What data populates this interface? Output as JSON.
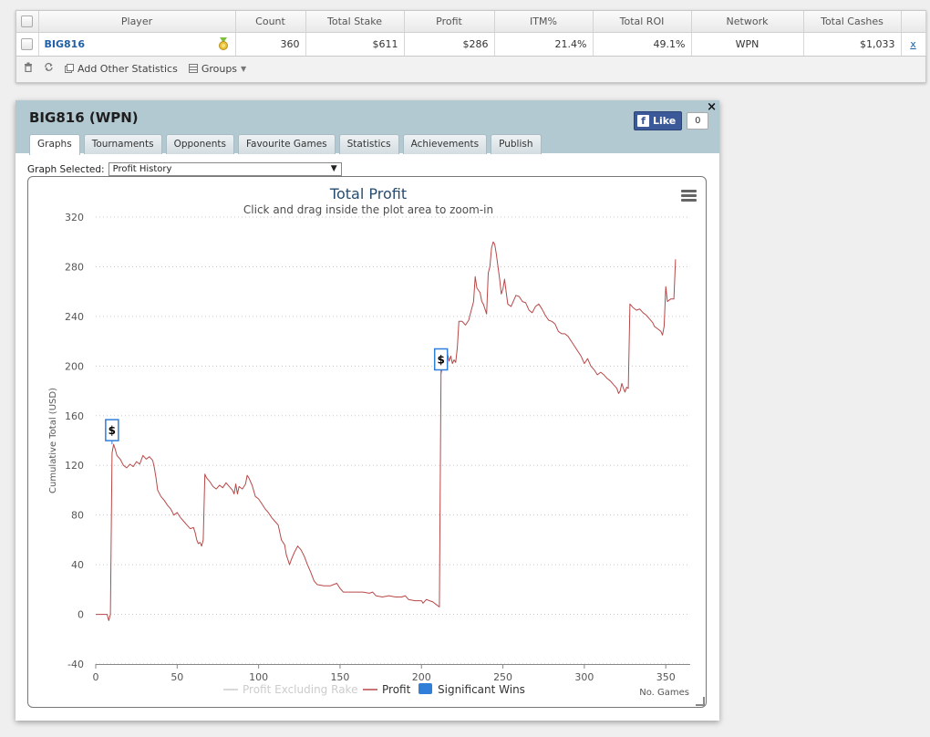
{
  "stats_table": {
    "headers": [
      "Player",
      "Count",
      "Total Stake",
      "Profit",
      "ITM%",
      "Total ROI",
      "Network",
      "Total Cashes"
    ],
    "row": {
      "player": "BIG816",
      "count": "360",
      "total_stake": "$611",
      "profit": "$286",
      "itm": "21.4%",
      "roi": "49.1%",
      "network": "WPN",
      "total_cashes": "$1,033",
      "remove": "x"
    },
    "toolbar": {
      "add_stats": "Add Other Statistics",
      "groups": "Groups"
    }
  },
  "panel": {
    "title": "BIG816 (WPN)",
    "close": "×",
    "like_label": "Like",
    "like_count": "0",
    "tabs": [
      "Graphs",
      "Tournaments",
      "Opponents",
      "Favourite Games",
      "Statistics",
      "Achievements",
      "Publish"
    ],
    "active_tab": "Graphs",
    "graph_selected_label": "Graph Selected:",
    "graph_selected_value": "Profit History"
  },
  "chart_data": {
    "type": "line",
    "title": "Total Profit",
    "subtitle": "Click and drag inside the plot area to zoom-in",
    "xlabel": "No. Games",
    "ylabel": "Cumulative Total (USD)",
    "xlim": [
      0,
      365
    ],
    "ylim": [
      -40,
      320
    ],
    "x_ticks": [
      0,
      50,
      100,
      150,
      200,
      250,
      300,
      350
    ],
    "y_ticks": [
      -40,
      0,
      40,
      80,
      120,
      160,
      200,
      240,
      280,
      320
    ],
    "grid": true,
    "legend": "bottom-center",
    "colors": {
      "profit": "#b84848",
      "profit_ex_rake": "#cccccc",
      "significant_wins": "#2f7ed8"
    },
    "legend_items": [
      "Profit Excluding Rake",
      "Profit",
      "Significant Wins"
    ],
    "series": [
      {
        "name": "Profit",
        "points": [
          [
            0,
            0
          ],
          [
            4,
            0
          ],
          [
            7,
            0
          ],
          [
            8,
            -5
          ],
          [
            9,
            0
          ],
          [
            10,
            130
          ],
          [
            11,
            137
          ],
          [
            12,
            133
          ],
          [
            13,
            128
          ],
          [
            15,
            125
          ],
          [
            17,
            120
          ],
          [
            19,
            118
          ],
          [
            21,
            121
          ],
          [
            23,
            119
          ],
          [
            25,
            123
          ],
          [
            27,
            121
          ],
          [
            29,
            128
          ],
          [
            31,
            125
          ],
          [
            33,
            127
          ],
          [
            35,
            124
          ],
          [
            36,
            118
          ],
          [
            37,
            110
          ],
          [
            38,
            100
          ],
          [
            40,
            95
          ],
          [
            42,
            92
          ],
          [
            44,
            88
          ],
          [
            46,
            85
          ],
          [
            48,
            80
          ],
          [
            50,
            82
          ],
          [
            52,
            78
          ],
          [
            54,
            75
          ],
          [
            56,
            72
          ],
          [
            58,
            69
          ],
          [
            60,
            70
          ],
          [
            61,
            66
          ],
          [
            62,
            60
          ],
          [
            63,
            57
          ],
          [
            64,
            58
          ],
          [
            65,
            55
          ],
          [
            66,
            60
          ],
          [
            67,
            113
          ],
          [
            68,
            110
          ],
          [
            70,
            107
          ],
          [
            72,
            103
          ],
          [
            74,
            101
          ],
          [
            76,
            104
          ],
          [
            78,
            102
          ],
          [
            80,
            106
          ],
          [
            82,
            103
          ],
          [
            84,
            100
          ],
          [
            85,
            97
          ],
          [
            86,
            105
          ],
          [
            87,
            97
          ],
          [
            88,
            103
          ],
          [
            90,
            101
          ],
          [
            92,
            105
          ],
          [
            93,
            112
          ],
          [
            94,
            110
          ],
          [
            96,
            104
          ],
          [
            98,
            95
          ],
          [
            100,
            93
          ],
          [
            102,
            89
          ],
          [
            104,
            85
          ],
          [
            106,
            82
          ],
          [
            108,
            78
          ],
          [
            110,
            75
          ],
          [
            112,
            72
          ],
          [
            113,
            66
          ],
          [
            114,
            60
          ],
          [
            116,
            56
          ],
          [
            117,
            48
          ],
          [
            118,
            44
          ],
          [
            119,
            40
          ],
          [
            120,
            44
          ],
          [
            122,
            50
          ],
          [
            124,
            55
          ],
          [
            126,
            52
          ],
          [
            128,
            47
          ],
          [
            130,
            40
          ],
          [
            132,
            34
          ],
          [
            134,
            27
          ],
          [
            136,
            24
          ],
          [
            140,
            23
          ],
          [
            144,
            23
          ],
          [
            146,
            24
          ],
          [
            148,
            25
          ],
          [
            150,
            21
          ],
          [
            152,
            18
          ],
          [
            156,
            18
          ],
          [
            160,
            18
          ],
          [
            164,
            18
          ],
          [
            168,
            17
          ],
          [
            170,
            18
          ],
          [
            172,
            15
          ],
          [
            176,
            14
          ],
          [
            180,
            15
          ],
          [
            184,
            14
          ],
          [
            188,
            14
          ],
          [
            190,
            15
          ],
          [
            192,
            12
          ],
          [
            196,
            11
          ],
          [
            200,
            11
          ],
          [
            201,
            9
          ],
          [
            203,
            12
          ],
          [
            205,
            11
          ],
          [
            207,
            10
          ],
          [
            209,
            8
          ],
          [
            211,
            6
          ],
          [
            212,
            194
          ],
          [
            213,
            200
          ],
          [
            214,
            197
          ],
          [
            215,
            202
          ],
          [
            216,
            210
          ],
          [
            217,
            204
          ],
          [
            218,
            208
          ],
          [
            219,
            202
          ],
          [
            220,
            205
          ],
          [
            221,
            203
          ],
          [
            222,
            215
          ],
          [
            223,
            236
          ],
          [
            225,
            236
          ],
          [
            227,
            233
          ],
          [
            229,
            237
          ],
          [
            230,
            242
          ],
          [
            232,
            252
          ],
          [
            233,
            272
          ],
          [
            234,
            263
          ],
          [
            236,
            259
          ],
          [
            237,
            252
          ],
          [
            238,
            250
          ],
          [
            240,
            242
          ],
          [
            241,
            275
          ],
          [
            242,
            280
          ],
          [
            243,
            295
          ],
          [
            244,
            300
          ],
          [
            245,
            298
          ],
          [
            246,
            290
          ],
          [
            247,
            280
          ],
          [
            248,
            270
          ],
          [
            249,
            258
          ],
          [
            250,
            262
          ],
          [
            251,
            270
          ],
          [
            252,
            260
          ],
          [
            253,
            250
          ],
          [
            255,
            248
          ],
          [
            257,
            254
          ],
          [
            258,
            257
          ],
          [
            260,
            256
          ],
          [
            262,
            252
          ],
          [
            264,
            251
          ],
          [
            266,
            245
          ],
          [
            268,
            243
          ],
          [
            270,
            248
          ],
          [
            272,
            250
          ],
          [
            274,
            246
          ],
          [
            276,
            241
          ],
          [
            278,
            237
          ],
          [
            280,
            236
          ],
          [
            282,
            234
          ],
          [
            284,
            228
          ],
          [
            286,
            226
          ],
          [
            288,
            226
          ],
          [
            290,
            224
          ],
          [
            292,
            220
          ],
          [
            294,
            216
          ],
          [
            296,
            212
          ],
          [
            298,
            208
          ],
          [
            300,
            202
          ],
          [
            302,
            206
          ],
          [
            304,
            200
          ],
          [
            306,
            197
          ],
          [
            308,
            193
          ],
          [
            310,
            195
          ],
          [
            312,
            193
          ],
          [
            314,
            190
          ],
          [
            316,
            188
          ],
          [
            318,
            185
          ],
          [
            320,
            182
          ],
          [
            321,
            178
          ],
          [
            322,
            180
          ],
          [
            323,
            186
          ],
          [
            324,
            182
          ],
          [
            325,
            179
          ],
          [
            326,
            183
          ],
          [
            327,
            182
          ],
          [
            328,
            250
          ],
          [
            330,
            247
          ],
          [
            332,
            245
          ],
          [
            334,
            246
          ],
          [
            336,
            243
          ],
          [
            338,
            241
          ],
          [
            340,
            238
          ],
          [
            342,
            235
          ],
          [
            343,
            232
          ],
          [
            345,
            230
          ],
          [
            347,
            228
          ],
          [
            348,
            225
          ],
          [
            349,
            232
          ],
          [
            350,
            264
          ],
          [
            351,
            252
          ],
          [
            352,
            253
          ],
          [
            353,
            254
          ],
          [
            355,
            254
          ],
          [
            356,
            286
          ]
        ]
      }
    ],
    "significant_wins": [
      {
        "x": 10,
        "y": 137,
        "label": "$"
      },
      {
        "x": 212,
        "y": 194,
        "label": "$"
      }
    ]
  }
}
